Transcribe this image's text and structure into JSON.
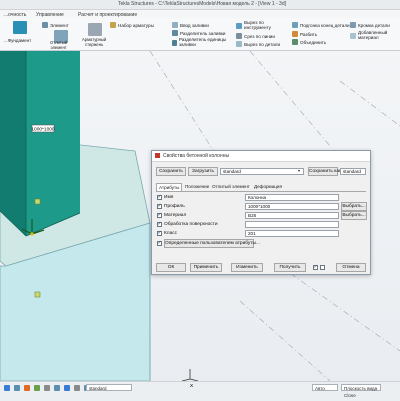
{
  "app": {
    "title": "Tekla Structures - C:\\TeklaStructuresModels\\Новая модель 2 - [View 1 - 3d]"
  },
  "menu_tabs": [
    "...очность",
    "Управление",
    "Расчет и проектирование"
  ],
  "ribbon": {
    "element_label": "Элемент",
    "fundament_label": "...Фундамент",
    "otlityi_label": "Отлитый\nэлемент",
    "armatura_label": "Арматурный\nстержень",
    "nabor_armatury": "Набор арматуры",
    "vvod_zalivki": "Ввод заливки",
    "razdelitel_zalivki": "Разделитель заливки",
    "edinitsy_zalivki": "Разделитель единицы заливки",
    "vyrez_instrument": "Вырез по\nинструменту",
    "srez_liniey": "Срез по линии",
    "vyrez_detali": "Вырез по детали",
    "podgonka": "Подгонка конец детали",
    "razbit": "Разбить",
    "obedinit": "Объединить",
    "kromka": "Кромка детали",
    "dop_material": "Добавленный\nматериал"
  },
  "viewport": {
    "column_label": "1000*1000"
  },
  "dialog": {
    "title": "Свойства бетонной колонны",
    "save_btn": "Сохранить",
    "load_btn": "Загрузить",
    "preset_value": "standard",
    "save_as_btn": "Сохранить как",
    "save_as_value": "standard",
    "tabs": [
      "Атрибуты",
      "Положение",
      "Отлитый элемент",
      "Деформация"
    ],
    "fields": {
      "name_label": "Имя",
      "name_value": "Колонна",
      "profile_label": "Профиль",
      "profile_value": "1000*1000",
      "material_label": "Материал",
      "material_value": "B25",
      "finish_label": "Обработка поверхности",
      "finish_value": "",
      "class_label": "Класс",
      "class_value": "201"
    },
    "choose_btn": "Выбрать...",
    "user_attr_btn": "Определенные пользователем атрибуты...",
    "ok": "ОК",
    "apply": "Применить",
    "modify": "Изменить",
    "get": "Получить",
    "cancel": "Отмена"
  },
  "status": {
    "snap_value": "standard",
    "x_label": "X",
    "mode_value": "Авто",
    "plane_value": "Плоскость вида",
    "close_label": "Close"
  },
  "colors": {
    "accent": "#1e9a8a",
    "teal_dark": "#137c70",
    "cube_face": "#c5e8ec",
    "cube_top": "#cfe8e6"
  }
}
